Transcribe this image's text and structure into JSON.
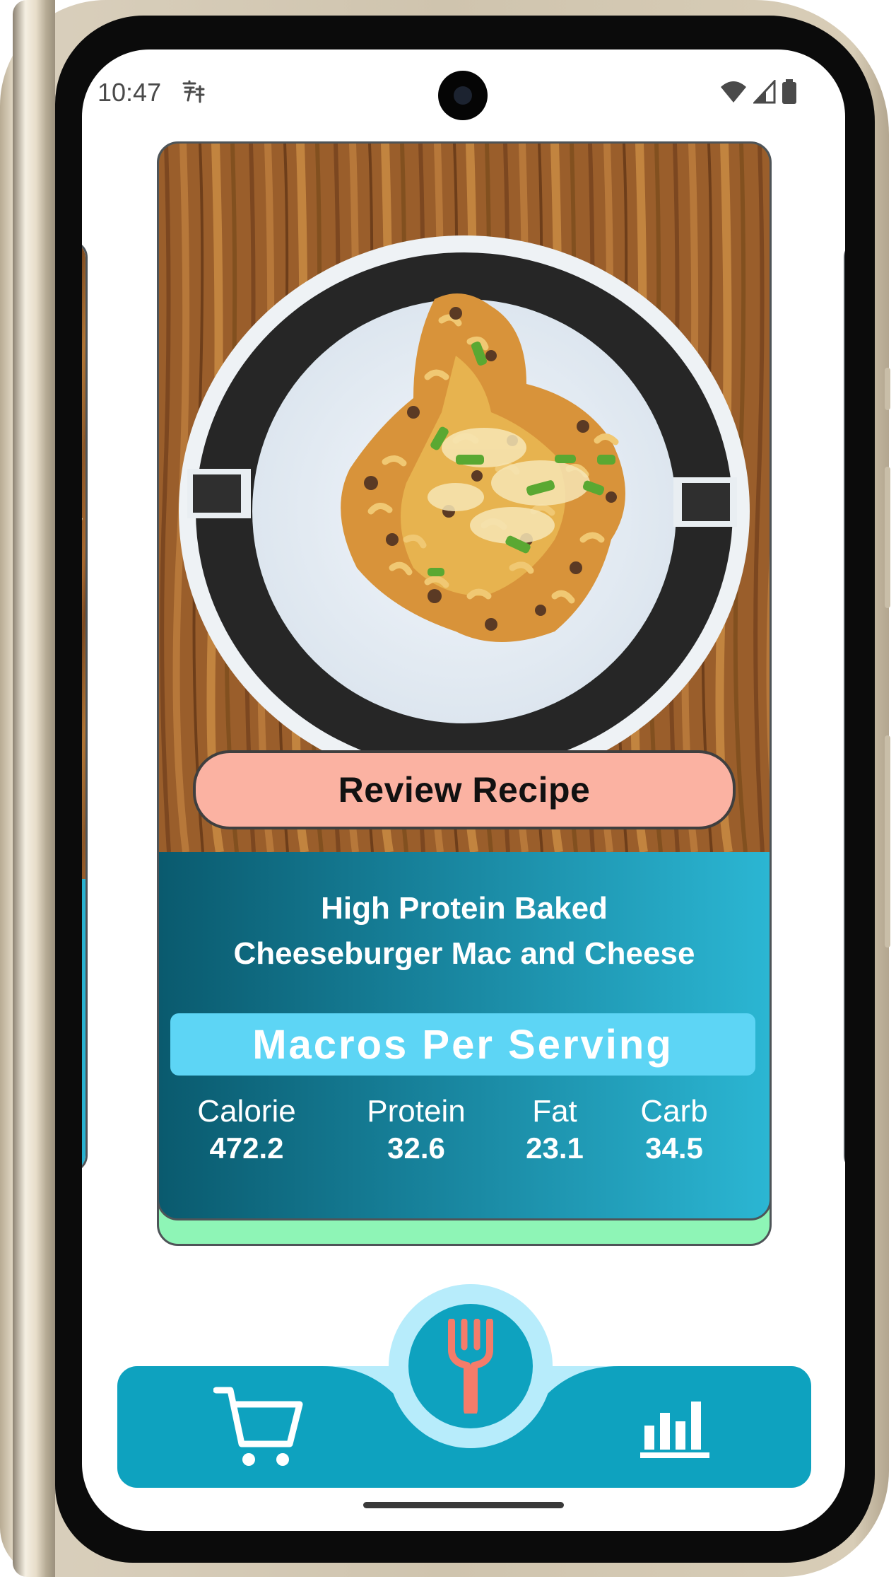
{
  "status_bar": {
    "time": "10:47",
    "notification_icon": "translate-icon",
    "icons": [
      "wifi-icon",
      "signal-icon",
      "battery-icon"
    ]
  },
  "recipe_card": {
    "review_button_label": "Review Recipe",
    "title_line1": "High Protein Baked",
    "title_line2": "Cheeseburger Mac and Cheese",
    "macros_header": "Macros Per Serving",
    "macros": [
      {
        "label": "Calorie",
        "value": "472.2"
      },
      {
        "label": "Protein",
        "value": "32.6"
      },
      {
        "label": "Fat",
        "value": "23.1"
      },
      {
        "label": "Carb",
        "value": "34.5"
      }
    ]
  },
  "bottom_nav": {
    "items": [
      {
        "icon": "shopping-cart-icon"
      },
      {
        "icon": "fork-icon",
        "active": true
      },
      {
        "icon": "bar-chart-icon"
      }
    ]
  },
  "colors": {
    "accent_teal": "#0ea2bf",
    "review_button": "#fbb2a2",
    "macros_header": "#5dd5f5",
    "card_shadow": "#8ef5b6",
    "fork_icon": "#f47c6a"
  }
}
